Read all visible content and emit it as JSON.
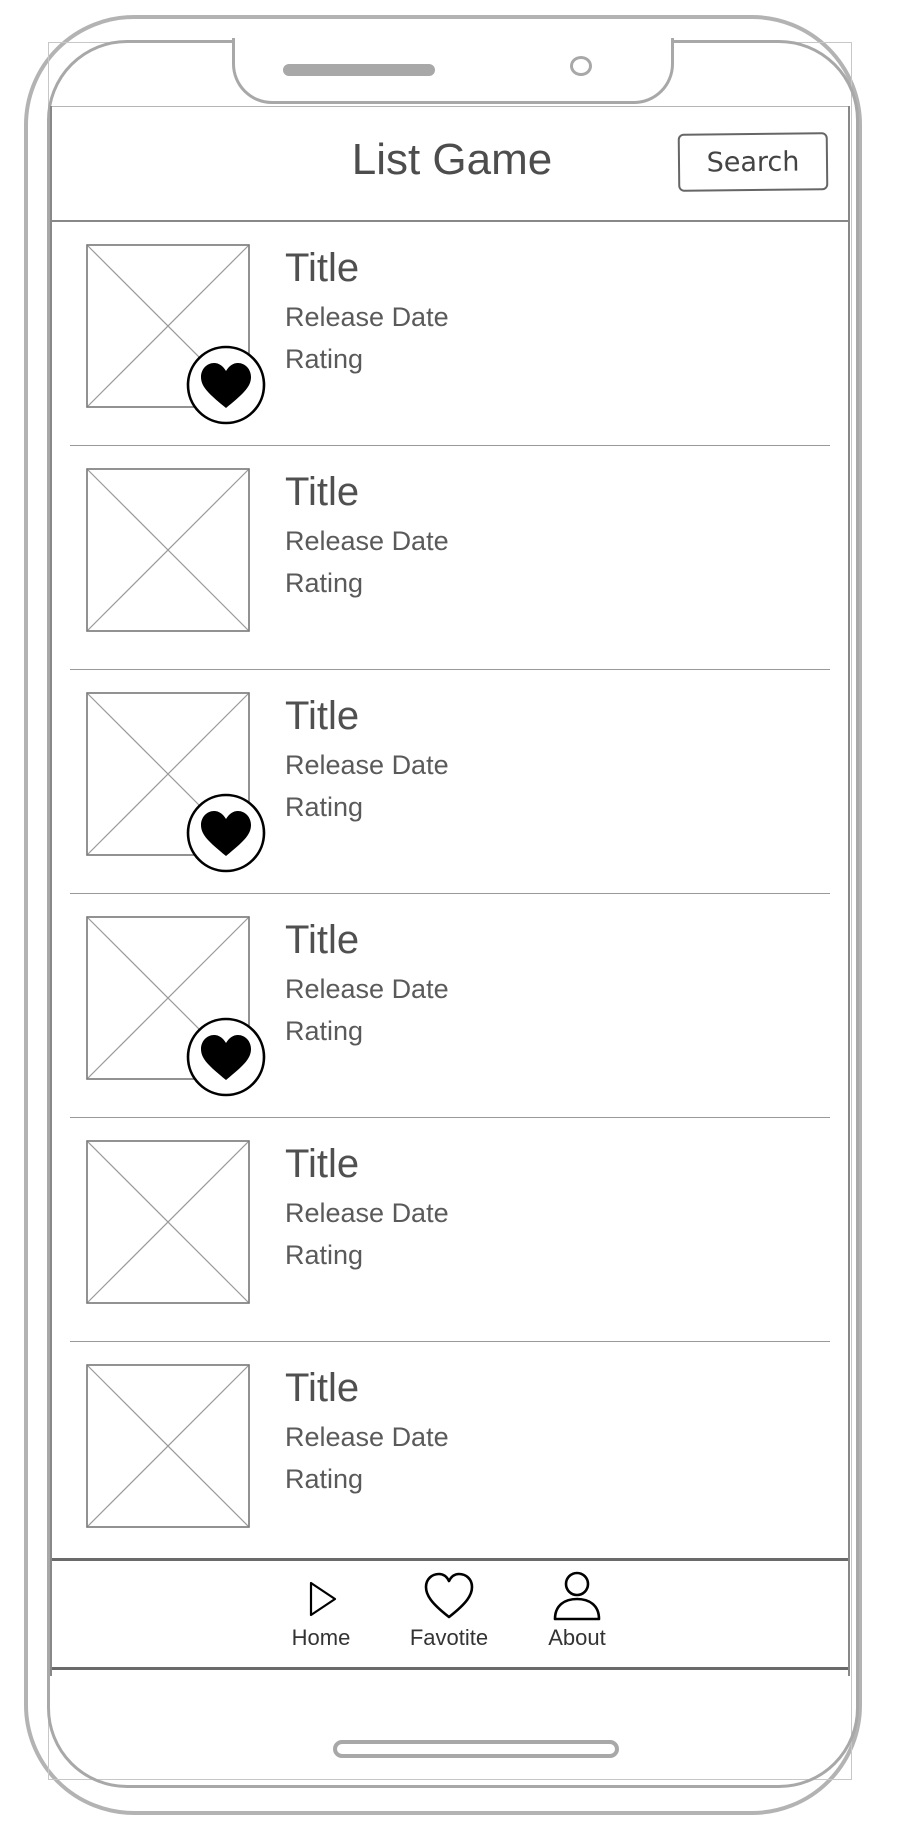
{
  "header": {
    "title": "List Game",
    "search_label": "Search"
  },
  "games": [
    {
      "title": "Title",
      "release_date": "Release Date",
      "rating": "Rating",
      "favorite": true
    },
    {
      "title": "Title",
      "release_date": "Release Date",
      "rating": "Rating",
      "favorite": false
    },
    {
      "title": "Title",
      "release_date": "Release Date",
      "rating": "Rating",
      "favorite": true
    },
    {
      "title": "Title",
      "release_date": "Release Date",
      "rating": "Rating",
      "favorite": true
    },
    {
      "title": "Title",
      "release_date": "Release Date",
      "rating": "Rating",
      "favorite": false
    },
    {
      "title": "Title",
      "release_date": "Release Date",
      "rating": "Rating",
      "favorite": false
    }
  ],
  "bottom_nav": {
    "items": [
      {
        "label": "Home",
        "icon": "play-icon"
      },
      {
        "label": "Favotite",
        "icon": "heart-outline-icon"
      },
      {
        "label": "About",
        "icon": "user-icon"
      }
    ]
  },
  "colors": {
    "frame": "#a8a8a8",
    "text": "#555555",
    "heart": "#000000"
  }
}
